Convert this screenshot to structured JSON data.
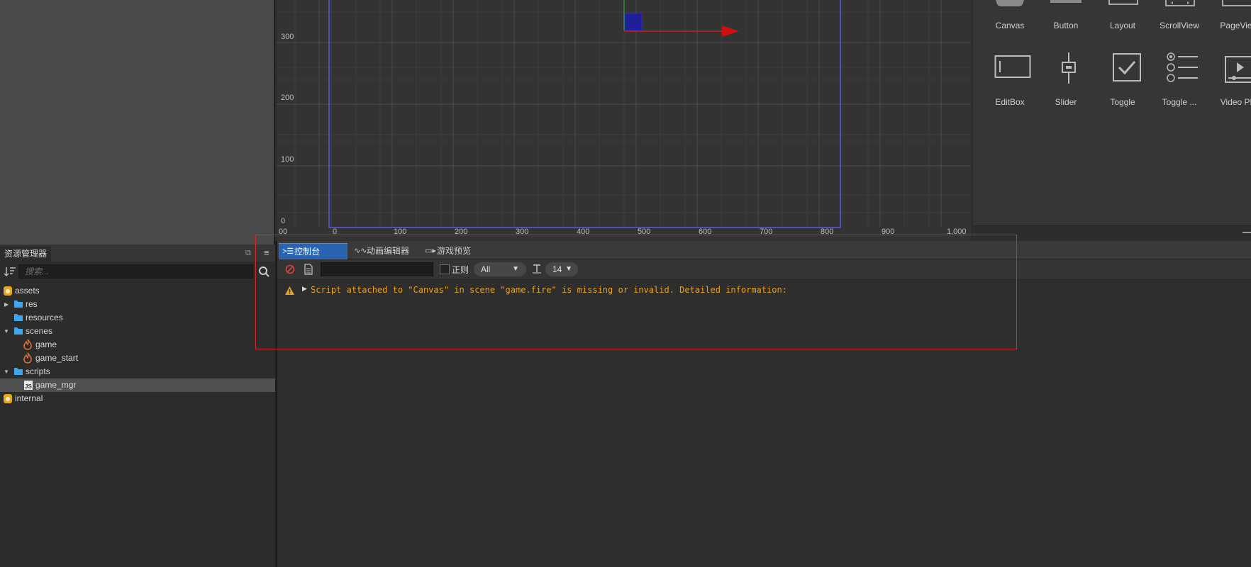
{
  "scene": {
    "y_labels": [
      "300",
      "200",
      "100",
      "0"
    ],
    "x_labels": [
      "00",
      "0",
      "100",
      "200",
      "300",
      "400",
      "500",
      "600",
      "700",
      "800",
      "900",
      "1,000"
    ]
  },
  "widgets": {
    "row1": [
      "Canvas",
      "Button",
      "Layout",
      "ScrollView",
      "PageVie"
    ],
    "row2": [
      "EditBox",
      "Slider",
      "Toggle",
      "Toggle ...",
      "Video Pl"
    ]
  },
  "assets": {
    "title": "资源管理器",
    "search_placeholder": "搜索...",
    "tree": [
      {
        "label": "assets",
        "icon": "db-icon"
      },
      {
        "label": "res",
        "icon": "folder-icon"
      },
      {
        "label": "resources",
        "icon": "folder-icon"
      },
      {
        "label": "scenes",
        "icon": "folder-icon"
      },
      {
        "label": "game",
        "icon": "fire-icon"
      },
      {
        "label": "game_start",
        "icon": "fire-icon"
      },
      {
        "label": "scripts",
        "icon": "folder-icon"
      },
      {
        "label": "game_mgr",
        "icon": "js-file-icon",
        "selected": true
      },
      {
        "label": "internal",
        "icon": "db-icon"
      }
    ]
  },
  "console": {
    "tabs": [
      {
        "label": "控制台",
        "icon": "terminal-icon",
        "active": true
      },
      {
        "label": "动画编辑器",
        "icon": "animation-icon"
      },
      {
        "label": "游戏预览",
        "icon": "preview-icon"
      }
    ],
    "filter_value": "",
    "regex_label": "正则",
    "level": "All",
    "font_size": "14",
    "log_message": "Script attached to \"Canvas\" in scene \"game.fire\" is missing or invalid. Detailed information:"
  },
  "colors": {
    "accent_tab": "#2a63b0",
    "warning": "#e8a020",
    "highlight": "#d42a2a",
    "canvas_frame": "#5a5ae0"
  }
}
